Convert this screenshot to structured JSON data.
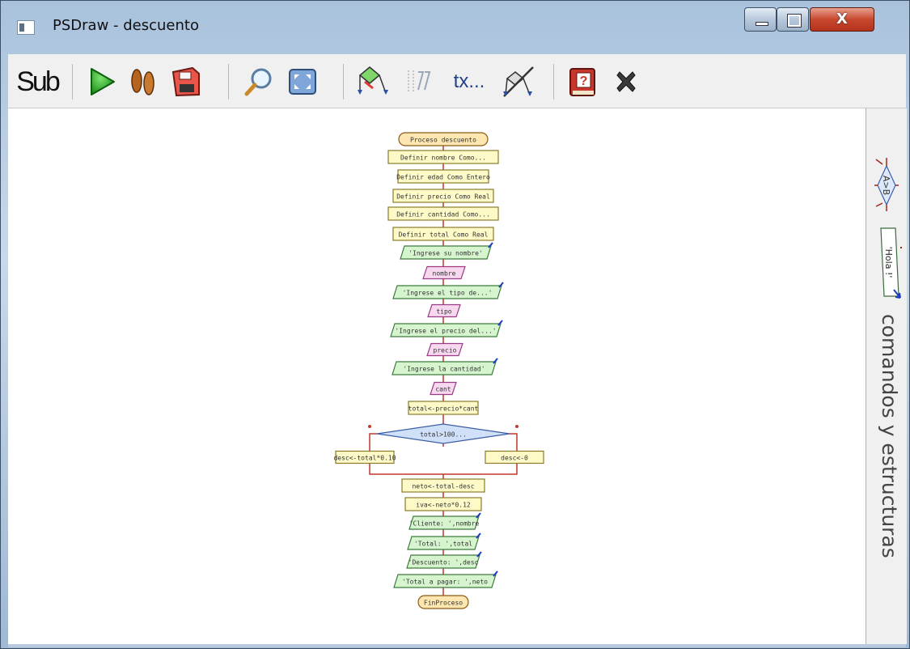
{
  "window": {
    "title": "PSDraw - descuento",
    "controls": {
      "minimize": "minimize",
      "maximize": "maximize",
      "close": "X"
    }
  },
  "toolbar": {
    "sub_label": "Sub",
    "tx_label": "tx...",
    "items": [
      {
        "name": "sub-button",
        "icon": "sub-text"
      },
      {
        "name": "run-button",
        "icon": "play-icon"
      },
      {
        "name": "step-button",
        "icon": "footprints-icon"
      },
      {
        "name": "save-button",
        "icon": "floppy-disk-icon"
      },
      {
        "name": "zoom-button",
        "icon": "magnifier-icon"
      },
      {
        "name": "fit-screen-button",
        "icon": "fit-screen-icon"
      },
      {
        "name": "show-colors-button",
        "icon": "flowchart-color-icon"
      },
      {
        "name": "comments-button",
        "icon": "comment-icon"
      },
      {
        "name": "text-button",
        "icon": "text-icon"
      },
      {
        "name": "crop-labels-button",
        "icon": "cut-flowchart-icon"
      },
      {
        "name": "help-button",
        "icon": "help-book-icon"
      },
      {
        "name": "close-diagram-button",
        "icon": "close-x-icon"
      }
    ]
  },
  "sidepanel": {
    "title": "comandos y estructuras",
    "example_condition": "A>B",
    "example_output": "'Hola !'"
  },
  "colors": {
    "start_end": "#fde6b0",
    "process": "#fdfac8",
    "input_output": "#d6f5cf",
    "read": "#f7d8ef",
    "decision": "#cfe0f8",
    "connector": "#c0392b"
  },
  "flowchart": {
    "nodes": [
      {
        "type": "start",
        "label": "Proceso descuento"
      },
      {
        "type": "process",
        "label": "Definir nombre Como..."
      },
      {
        "type": "process",
        "label": "Definir edad Como Entero"
      },
      {
        "type": "process",
        "label": "Definir precio Como Real"
      },
      {
        "type": "process",
        "label": "Definir cantidad Como..."
      },
      {
        "type": "process",
        "label": "Definir total Como Real"
      },
      {
        "type": "output",
        "label": "'Ingrese su nombre'"
      },
      {
        "type": "read",
        "label": "nombre"
      },
      {
        "type": "output",
        "label": "'Ingrese el tipo de...'"
      },
      {
        "type": "read",
        "label": "tipo"
      },
      {
        "type": "output",
        "label": "'Ingrese el precio del...'"
      },
      {
        "type": "read",
        "label": "precio"
      },
      {
        "type": "output",
        "label": "'Ingrese la cantidad'"
      },
      {
        "type": "read",
        "label": "cant"
      },
      {
        "type": "process",
        "label": "total<-precio*cant"
      },
      {
        "type": "decision",
        "label": "total>100..."
      },
      {
        "type": "process",
        "label": "desc<-total*0.10"
      },
      {
        "type": "process",
        "label": "desc<-0"
      },
      {
        "type": "process",
        "label": "neto<-total-desc"
      },
      {
        "type": "process",
        "label": "iva<-neto*0.12"
      },
      {
        "type": "output",
        "label": "'Cliente: ',nombre"
      },
      {
        "type": "output",
        "label": "'Total: ',total"
      },
      {
        "type": "output",
        "label": "'Descuento: ',desc"
      },
      {
        "type": "output",
        "label": "'Total a pagar: ',neto"
      },
      {
        "type": "end",
        "label": "FinProceso"
      }
    ]
  }
}
